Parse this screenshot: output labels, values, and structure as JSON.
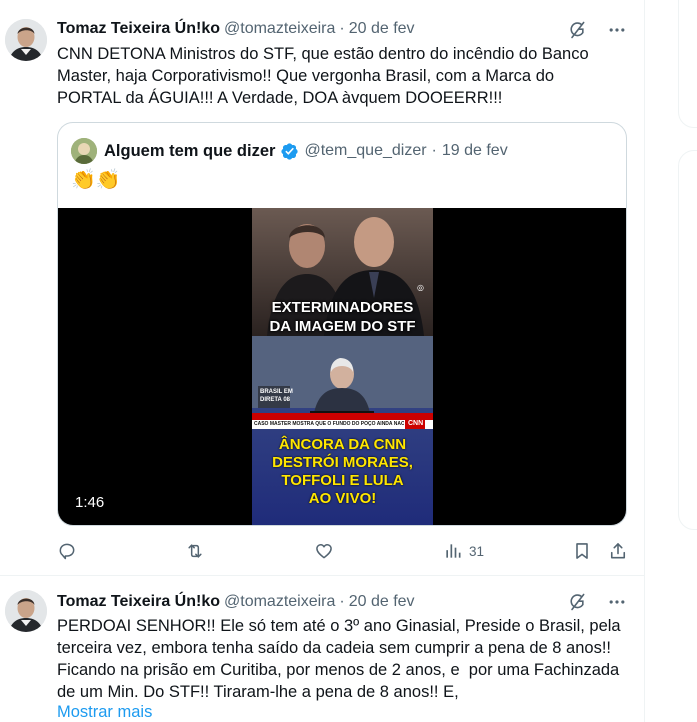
{
  "tweets": [
    {
      "author_name": "Tomaz Teixeira Ún!ko",
      "handle": "@tomazteixeira",
      "separator": "·",
      "time": "20 de fev",
      "text": "CNN DETONA Ministros do STF, que estão dentro do incêndio do Banco\nMaster, haja Corporativismo!! Que vergonha Brasil, com a Marca do\nPORTAL da ÁGUIA!!! A Verdade, DOA àvquem DOOEERR!!!",
      "quote": {
        "author_name": "Alguem tem que dizer",
        "handle": "@tem_que_dizer",
        "separator": "·",
        "time": "19 de fev",
        "text": "👏👏",
        "video": {
          "duration": "1:46",
          "headline_top_line1": "EXTERMINADORES",
          "headline_top_line2": "DA IMAGEM DO STF",
          "badge_line1": "BRASIL EM",
          "badge_line2": "DIRETA 08",
          "ticker": "CASO MASTER MOSTRA QUE O FUNDO DO POÇO AINDA NÃO CHEGOU",
          "headline_bottom_line1": "ÂNCORA DA CNN",
          "headline_bottom_line2": "DESTRÓI MORAES,",
          "headline_bottom_line3": "TOFFOLI E LULA",
          "headline_bottom_line4": "AO VIVO!"
        }
      },
      "stats": {
        "views": "31"
      }
    },
    {
      "author_name": "Tomaz Teixeira Ún!ko",
      "handle": "@tomazteixeira",
      "separator": "·",
      "time": "20 de fev",
      "text": "PERDOAI SENHOR!! Ele só tem até o 3º ano Ginasial, Preside o Brasil, pela\nterceira vez, embora tenha saído da cadeia sem cumprir a pena de 8 anos!!\nFicando na prisão em Curitiba, por menos de 2 anos, e  por uma Fachinzada\nde um Min. Do STF!! Tiraram-lhe a pena de 8 anos!! E,",
      "show_more": "Mostrar mais"
    }
  ],
  "icons": {
    "grok": "grok-icon",
    "more": "more-icon",
    "reply": "reply-icon",
    "repost": "repost-icon",
    "like": "like-icon",
    "views": "views-icon",
    "bookmark": "bookmark-icon",
    "share": "share-icon",
    "verified": "verified-badge-icon"
  },
  "colors": {
    "text": "#0f1419",
    "secondary": "#536471",
    "link": "#1d9bf0",
    "border": "#eff3f4",
    "cnn_red": "#cc0000",
    "headline_yellow": "#ffe600",
    "bottom_panel": "#2a3a9a"
  }
}
